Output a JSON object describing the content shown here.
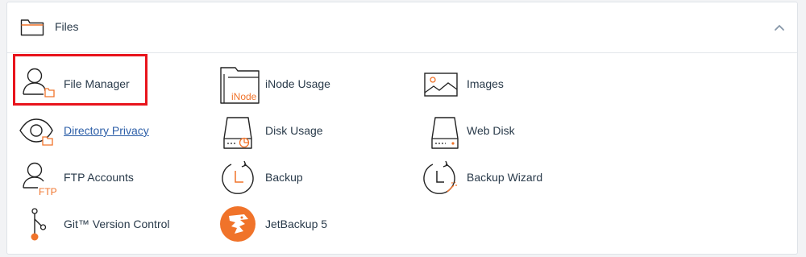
{
  "section": {
    "title": "Files",
    "icon": "folder-icon"
  },
  "colors": {
    "accent": "#f0732a",
    "highlight": "#e8141c",
    "link": "#2d5fa8",
    "text": "#293a4a"
  },
  "items": [
    {
      "label": "File Manager",
      "icon": "file-manager-icon",
      "highlighted": true
    },
    {
      "label": "iNode Usage",
      "icon": "inode-usage-icon",
      "icon_text": "iNode"
    },
    {
      "label": "Images",
      "icon": "images-icon"
    },
    {
      "label": "Directory Privacy",
      "icon": "directory-privacy-icon",
      "link": true
    },
    {
      "label": "Disk Usage",
      "icon": "disk-usage-icon"
    },
    {
      "label": "Web Disk",
      "icon": "web-disk-icon"
    },
    {
      "label": "FTP Accounts",
      "icon": "ftp-accounts-icon",
      "icon_text": "FTP"
    },
    {
      "label": "Backup",
      "icon": "backup-icon"
    },
    {
      "label": "Backup Wizard",
      "icon": "backup-wizard-icon"
    },
    {
      "label": "Git™ Version Control",
      "icon": "git-version-control-icon"
    },
    {
      "label": "JetBackup 5",
      "icon": "jetbackup-icon"
    }
  ]
}
